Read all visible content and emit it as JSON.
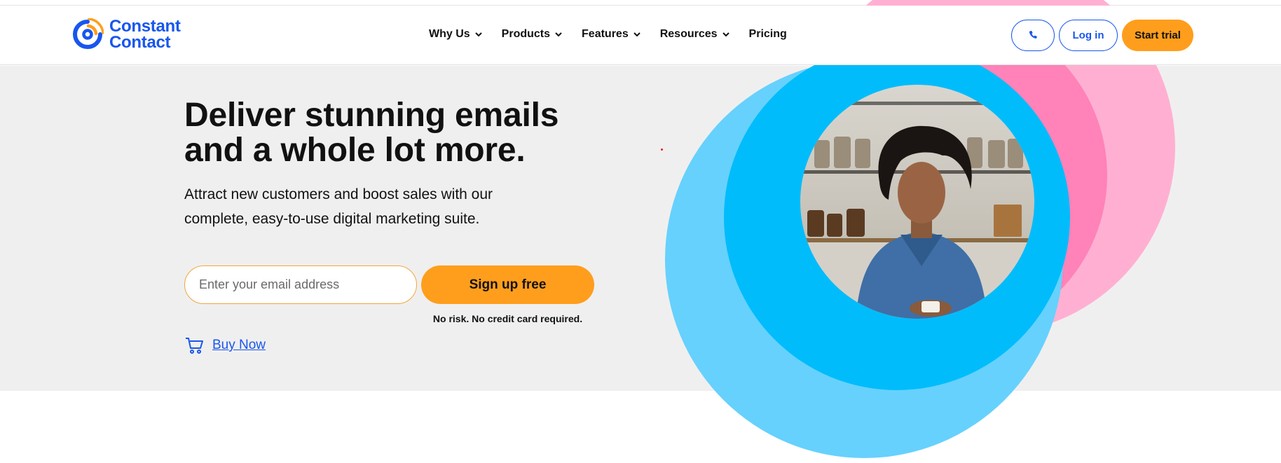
{
  "brand": {
    "name_line1": "Constant",
    "name_line2": "Contact",
    "logo_icon": "constant-contact-logo",
    "colors": {
      "primary_blue": "#1856ed",
      "accent_orange": "#ff9e1c",
      "hero_bg": "#f0efef",
      "circle_light_blue": "#66d1fd",
      "circle_blue": "#01bcfb",
      "circle_light_pink": "#ffb0d2",
      "circle_pink": "#ff82b9"
    }
  },
  "nav": {
    "items": [
      {
        "label": "Why Us",
        "has_dropdown": true
      },
      {
        "label": "Products",
        "has_dropdown": true
      },
      {
        "label": "Features",
        "has_dropdown": true
      },
      {
        "label": "Resources",
        "has_dropdown": true
      },
      {
        "label": "Pricing",
        "has_dropdown": false
      }
    ]
  },
  "header_actions": {
    "phone_icon": "phone-icon",
    "login_label": "Log in",
    "start_trial_label": "Start trial"
  },
  "hero": {
    "headline_line1": "Deliver stunning emails",
    "headline_line2": "and a whole lot more.",
    "subtext_line1": "Attract new customers and boost sales with our",
    "subtext_line2": "complete, easy-to-use digital marketing suite.",
    "email_placeholder": "Enter your email address",
    "signup_label": "Sign up free",
    "no_risk_text": "No risk. No credit card required.",
    "buy_now_label": "Buy Now",
    "cart_icon": "shopping-cart-icon",
    "photo": "woman-smiling-photo"
  }
}
